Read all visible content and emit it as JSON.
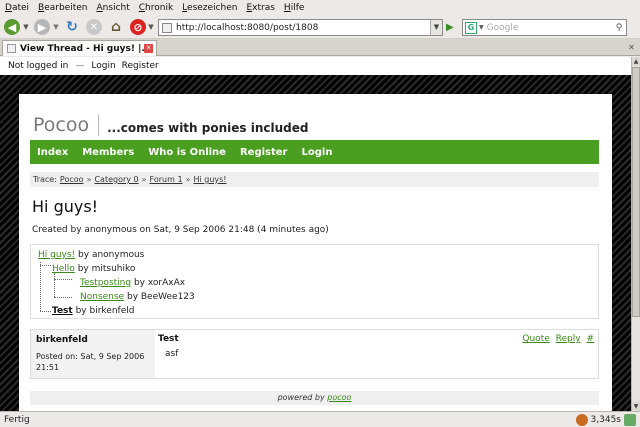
{
  "menubar": [
    "Datei",
    "Bearbeiten",
    "Ansicht",
    "Chronik",
    "Lesezeichen",
    "Extras",
    "Hilfe"
  ],
  "toolbar": {
    "url": "http://localhost:8080/post/1808",
    "search_placeholder": "Google",
    "search_engine_letter": "G"
  },
  "tab": {
    "title": "View Thread - Hi guys! |..."
  },
  "page": {
    "topline": {
      "status": "Not logged in",
      "login": "Login",
      "register": "Register"
    },
    "logo": "Pocoo",
    "slogan": "...comes with ponies included",
    "nav": [
      "Index",
      "Members",
      "Who is Online",
      "Register",
      "Login"
    ],
    "trace": {
      "label": "Trace:",
      "items": [
        "Pocoo",
        "Category 0",
        "Forum 1",
        "Hi guys!"
      ],
      "sep": "»"
    },
    "title": "Hi guys!",
    "created": "Created by anonymous on Sat, 9 Sep 2006 21:48 (4 minutes ago)",
    "tree": [
      {
        "title": "Hi guys!",
        "by": "by anonymous"
      },
      {
        "title": "Hello",
        "by": "by mitsuhiko"
      },
      {
        "title": "Testposting",
        "by": "by xorAxAx"
      },
      {
        "title": "Nonsense",
        "by": "by BeeWee123"
      },
      {
        "title": "Test",
        "by": "by birkenfeld"
      }
    ],
    "post": {
      "author": "birkenfeld",
      "posted": "Posted on: Sat, 9 Sep 2006 21:51",
      "title": "Test",
      "body": "asf",
      "actions": [
        "Quote",
        "Reply",
        "#"
      ]
    },
    "footer": {
      "text": "powered by",
      "link": "pocoo"
    }
  },
  "status": {
    "text": "Fertig",
    "time": "3,345s"
  },
  "colors": {
    "nav_green": "#4a9e20",
    "link_green": "#3a8a1a"
  }
}
